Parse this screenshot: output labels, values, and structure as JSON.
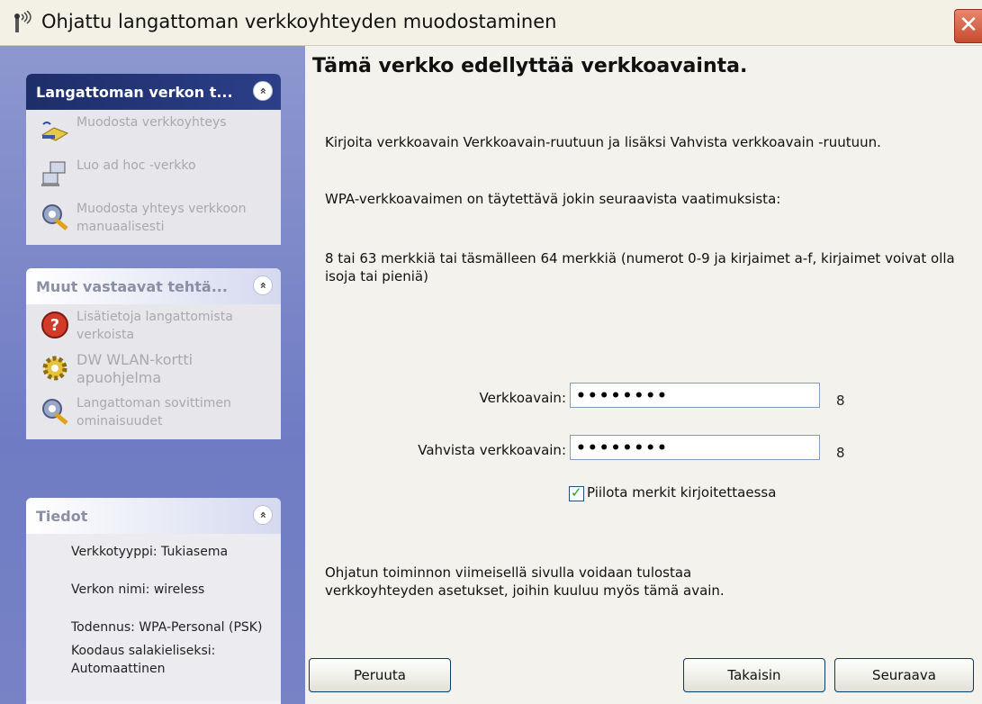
{
  "window": {
    "title": "Ohjattu langattoman verkkoyhteyden muodostaminen",
    "close_glyph": "✕"
  },
  "sidebar": {
    "panel1": {
      "title": "Langattoman verkon t...",
      "items": [
        {
          "label": "Muodosta verkkoyhteys",
          "icon": "connect-icon"
        },
        {
          "label": "Luo ad hoc -verkko",
          "icon": "adhoc-icon"
        },
        {
          "label": "Muodosta yhteys verkkoon manuaalisesti",
          "icon": "manual-settings-icon"
        }
      ]
    },
    "panel2": {
      "title": "Muut vastaavat tehtä...",
      "items": [
        {
          "label": "Lisätietoja langattomista verkoista",
          "icon": "help-icon"
        },
        {
          "label": "DW WLAN-kortti apuohjelma",
          "icon": "gear-icon"
        },
        {
          "label": "Langattoman sovittimen ominaisuudet",
          "icon": "adapter-settings-icon"
        }
      ]
    },
    "panel3": {
      "title": "Tiedot",
      "rows": [
        "Verkkotyyppi: Tukiasema",
        "Verkon nimi: wireless",
        "Todennus: WPA-Personal (PSK)",
        "Koodaus salakieliseksi: Automaattinen"
      ]
    },
    "collapse_glyph": "»"
  },
  "main": {
    "heading": "Tämä verkko edellyttää verkkoavainta.",
    "instruction": "Kirjoita verkkoavain Verkkoavain-ruutuun ja lisäksi Vahvista verkkoavain -ruutuun.",
    "requirement_intro": "WPA-verkkoavaimen on täytettävä jokin seuraavista vaatimuksista:",
    "requirement": "8 tai 63 merkkiä tai täsmälleen 64 merkkiä (numerot 0-9 ja kirjaimet a-f, kirjaimet voivat olla isoja tai pieniä)",
    "key_label": "Verkkoavain:",
    "key_value": "••••••••",
    "key_count": "8",
    "confirm_label": "Vahvista verkkoavain:",
    "confirm_value": "••••••••",
    "confirm_count": "8",
    "hide_chars_label": "Piilota merkit kirjoitettaessa",
    "hide_chars_checked": true,
    "footer_note": "Ohjatun toiminnon viimeisellä sivulla voidaan tulostaa verkkoyhteyden asetukset, joihin kuuluu myös tämä avain."
  },
  "buttons": {
    "cancel": "Peruuta",
    "back": "Takaisin",
    "next": "Seuraava"
  }
}
